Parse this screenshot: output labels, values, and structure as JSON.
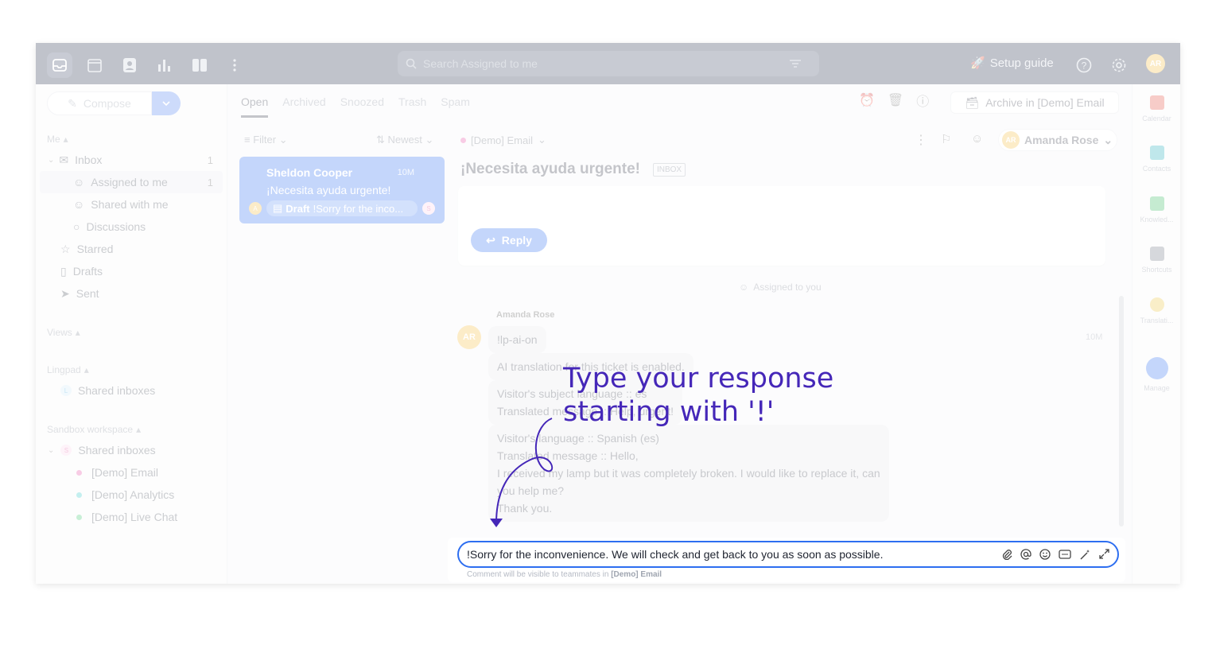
{
  "topbar": {
    "search_placeholder": "Search Assigned to me",
    "calendar_day": "31",
    "setup_guide": "Setup guide",
    "avatar_initials": "AR"
  },
  "sidebar": {
    "compose_label": "Compose",
    "me_section": "Me",
    "inbox_label": "Inbox",
    "inbox_count": "1",
    "assigned_label": "Assigned to me",
    "assigned_count": "1",
    "shared_with_me": "Shared with me",
    "discussions": "Discussions",
    "starred": "Starred",
    "drafts": "Drafts",
    "sent": "Sent",
    "views_section": "Views",
    "lingpad_section": "Lingpad",
    "lingpad_shared": "Shared inboxes",
    "lingpad_badge": "L",
    "sandbox_section": "Sandbox workspace",
    "sandbox_shared": "Shared inboxes",
    "sandbox_badge": "S",
    "demo_email": "[Demo] Email",
    "demo_analytics": "[Demo] Analytics",
    "demo_livechat": "[Demo] Live Chat"
  },
  "tabs": [
    "Open",
    "Archived",
    "Snoozed",
    "Trash",
    "Spam"
  ],
  "toolbar": {
    "archive_label": "Archive in [Demo] Email"
  },
  "list": {
    "filter": "Filter",
    "sort": "Newest",
    "card": {
      "name": "Sheldon Cooper",
      "time": "10M",
      "subject": "¡Necesita ayuda urgente!",
      "draft_label": "Draft",
      "draft_preview": "!Sorry for the inco...",
      "avatar_left": "A",
      "avatar_right": "S"
    }
  },
  "conversation": {
    "inbox_name": "[Demo] Email",
    "title": "¡Necesita ayuda urgente!",
    "badge": "INBOX",
    "assignee": "Amanda Rose",
    "assignee_initials": "AR",
    "reply_label": "Reply",
    "assigned_note": "Assigned to you",
    "author": "Amanda Rose",
    "author_initials": "AR",
    "msg_time": "10M",
    "bubble1": "!lp-ai-on",
    "bubble2": "AI translation for this ticket is enabled.",
    "bubble3_l1": "Visitor's subject language :: es",
    "bubble3_l2": "Translated message :: Help, urgent!",
    "bubble4_l1": "Visitor's language :: Spanish (es)",
    "bubble4_l2": "Translated message :: Hello,",
    "bubble4_l3": "I received my lamp but it was completely broken. I would like to replace it, can",
    "bubble4_l4": "you help me?",
    "bubble4_l5": "Thank you."
  },
  "right_rail": [
    "Calendar",
    "Contacts",
    "Knowled...",
    "Shortcuts",
    "Translati...",
    "Manage"
  ],
  "composer": {
    "value": "!Sorry for the inconvenience. We will check and get back to you as soon as possible.",
    "hint_prefix": "Comment will be visible to teammates in",
    "hint_inbox": "[Demo] Email"
  },
  "annotation": {
    "line1": "Type your response",
    "line2": "starting with '!'"
  },
  "colors": {
    "accent": "#2d6ef0",
    "annotation": "#4527b8",
    "topbar": "#1f2a44"
  }
}
